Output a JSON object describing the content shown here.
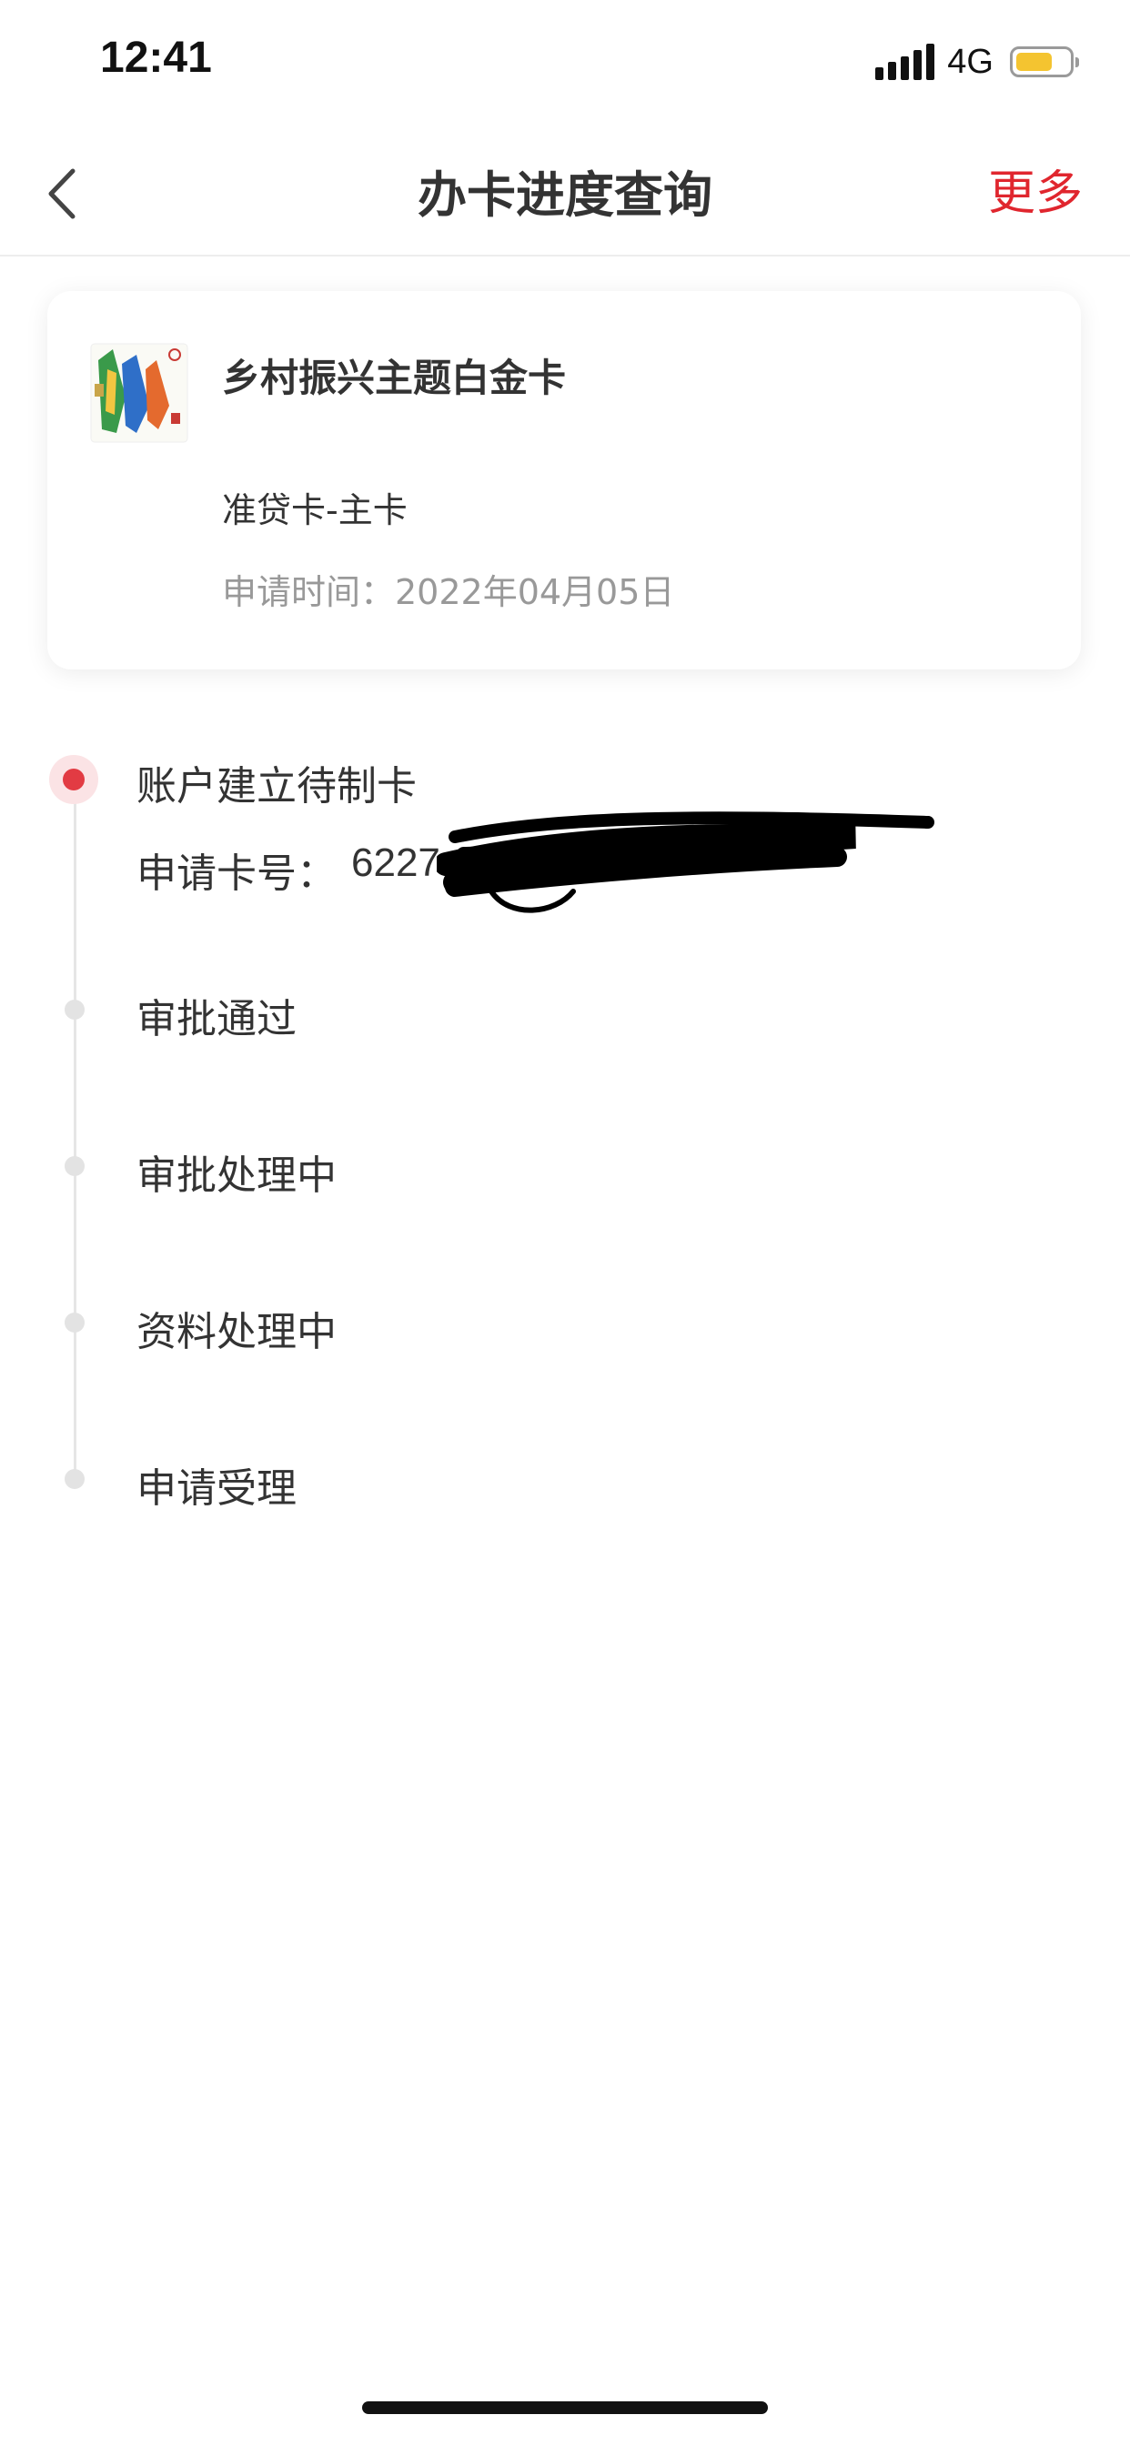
{
  "status_bar": {
    "time": "12:41",
    "network": "4G",
    "battery_color": "#f4c430",
    "battery_level": 0.7
  },
  "nav": {
    "title": "办卡进度查询",
    "more_label": "更多",
    "accent_color": "#e0262e"
  },
  "card": {
    "name": "乡村振兴主题白金卡",
    "type": "准贷卡-主卡",
    "apply_time": "申请时间：2022年04月05日"
  },
  "timeline": {
    "steps": [
      {
        "label": "账户建立待制卡",
        "active": true,
        "card_no_label": "申请卡号：",
        "card_no_value": "6227"
      },
      {
        "label": "审批通过",
        "active": false
      },
      {
        "label": "审批处理中",
        "active": false
      },
      {
        "label": "资料处理中",
        "active": false
      },
      {
        "label": "申请受理",
        "active": false
      }
    ]
  }
}
